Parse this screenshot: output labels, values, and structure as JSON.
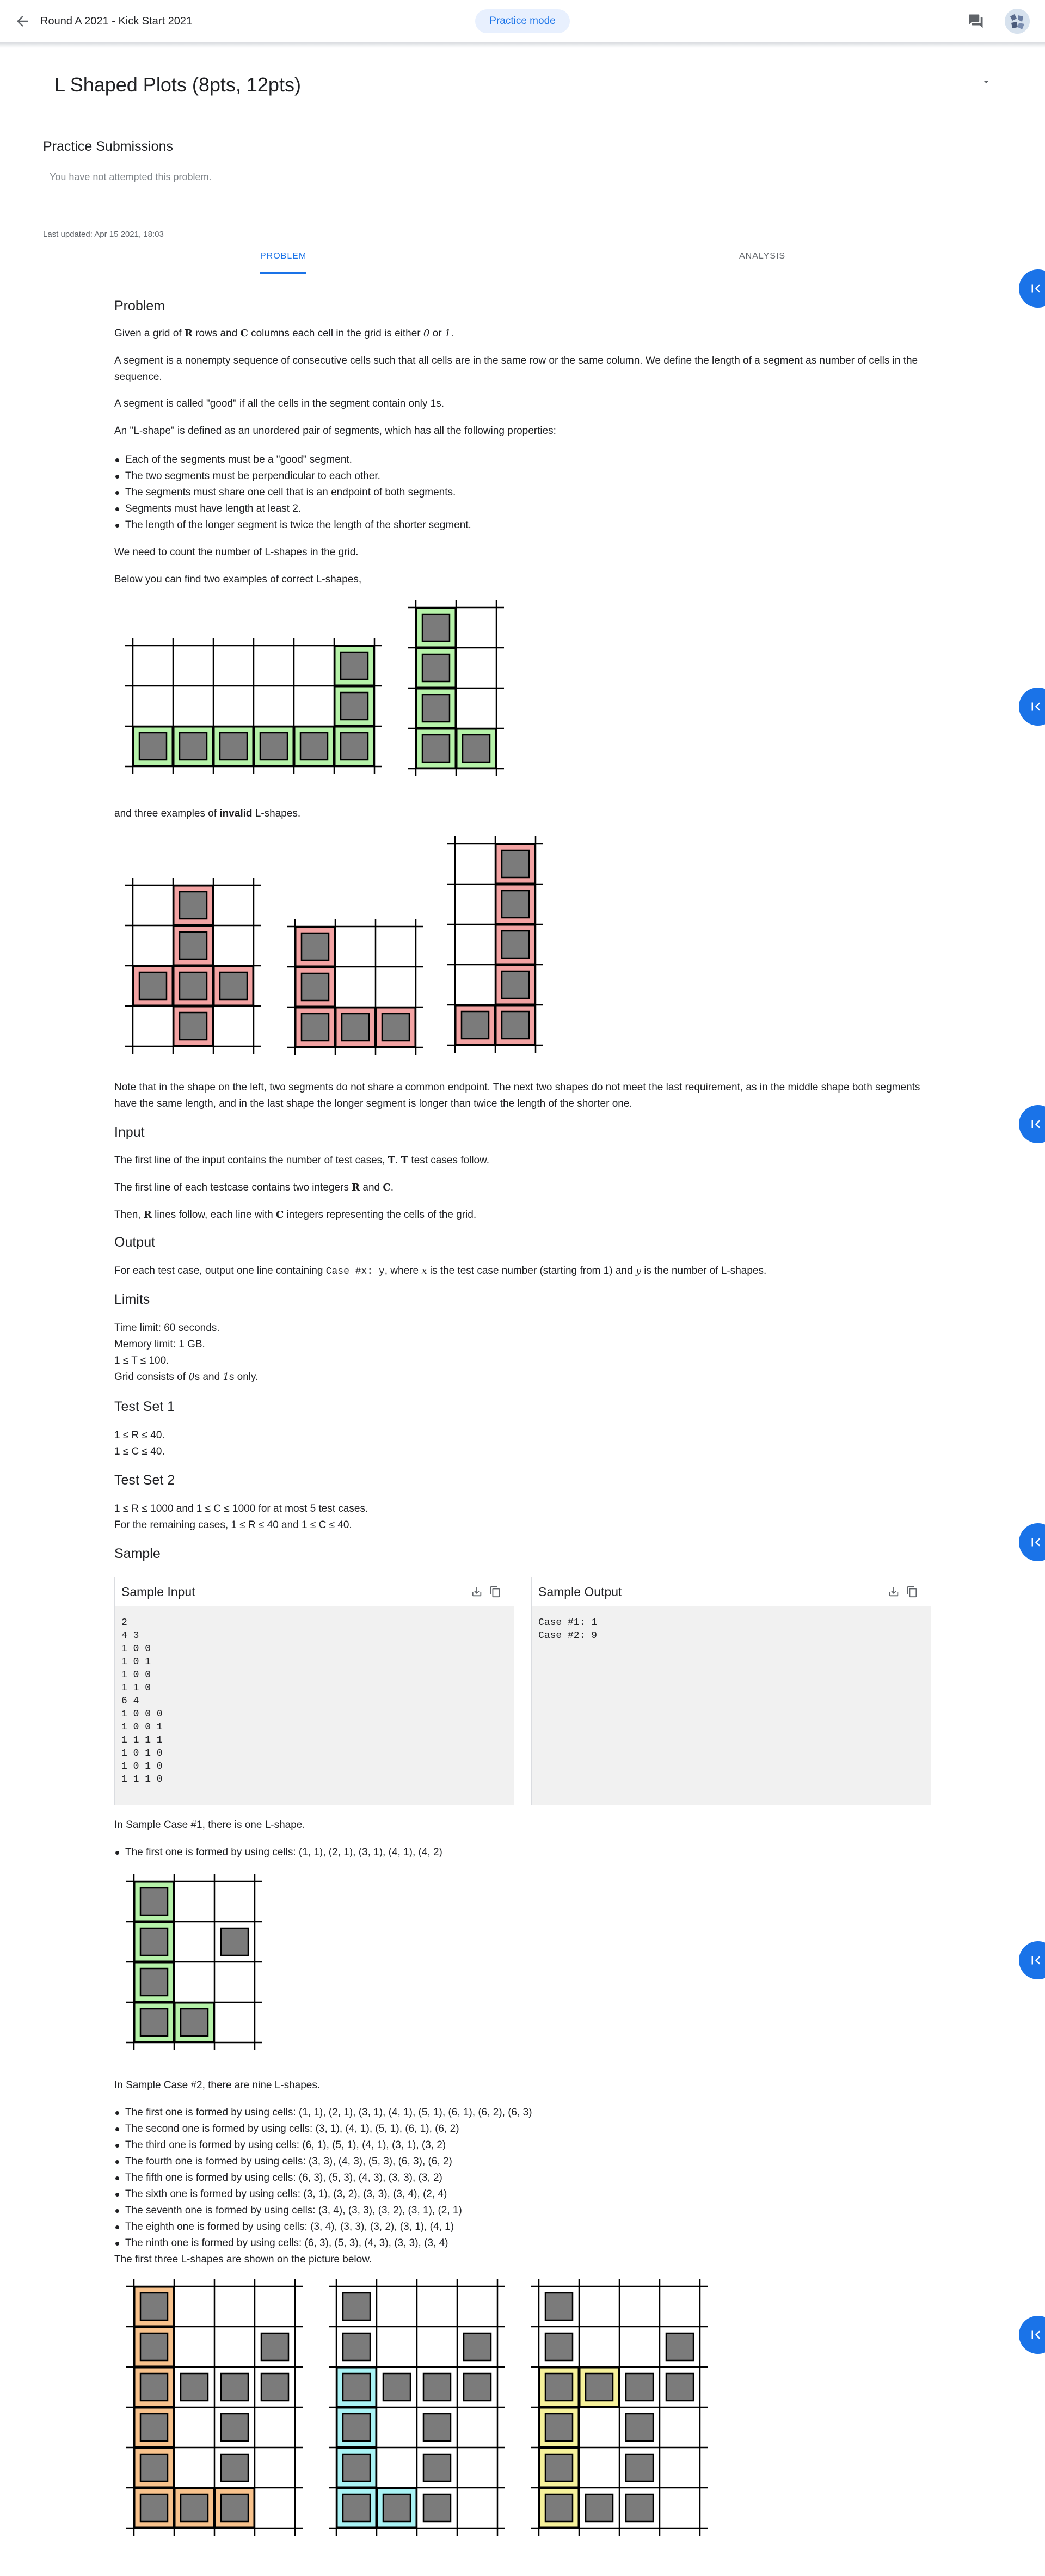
{
  "header": {
    "round_title": "Round A 2021 - Kick Start 2021",
    "mode_label": "Practice mode"
  },
  "problem_title": "L Shaped Plots (8pts, 12pts)",
  "practice": {
    "title": "Practice Submissions",
    "empty_text": "You have not attempted this problem."
  },
  "last_updated": "Last updated: Apr 15 2021, 18:03",
  "tabs": {
    "problem": "PROBLEM",
    "analysis": "ANALYSIS"
  },
  "statement": {
    "problem_heading": "Problem",
    "p1_a": "Given a grid of ",
    "p1_R": "R",
    "p1_b": " rows and ",
    "p1_C": "C",
    "p1_c": " columns each cell in the grid is either ",
    "p1_zero": "0",
    "p1_d": " or ",
    "p1_one": "1",
    "p1_e": ".",
    "p2": "A segment is a nonempty sequence of consecutive cells such that all cells are in the same row or the same column. We define the length of a segment as number of cells in the sequence.",
    "p3": "A segment is called \"good\" if all the cells in the segment contain only 1s.",
    "p4": "An \"L-shape\" is defined as an unordered pair of segments, which has all the following properties:",
    "props": [
      "Each of the segments must be a \"good\" segment.",
      "The two segments must be perpendicular to each other.",
      "The segments must share one cell that is an endpoint of both segments.",
      "Segments must have length at least 2.",
      "The length of the longer segment is twice the length of the shorter segment."
    ],
    "p5": "We need to count the number of L-shapes in the grid.",
    "p6": "Below you can find two examples of correct L-shapes,",
    "p7_a": "and three examples of ",
    "p7_b": "invalid",
    "p7_c": " L-shapes.",
    "p8": "Note that in the shape on the left, two segments do not share a common endpoint. The next two shapes do not meet the last requirement, as in the middle shape both segments have the same length, and in the last shape the longer segment is longer than twice the length of the shorter one.",
    "input_heading": "Input",
    "in1_a": "The first line of the input contains the number of test cases, ",
    "in1_T": "T",
    "in1_b": ". ",
    "in1_T2": "T",
    "in1_c": " test cases follow.",
    "in2_a": "The first line of each testcase contains two integers ",
    "in2_R": "R",
    "in2_b": " and ",
    "in2_C": "C",
    "in2_c": ".",
    "in3_a": "Then, ",
    "in3_R": "R",
    "in3_b": " lines follow, each line with ",
    "in3_C": "C",
    "in3_c": " integers representing the cells of the grid.",
    "output_heading": "Output",
    "out_a": "For each test case, output one line containing ",
    "out_code": "Case #x: y",
    "out_b": ", where ",
    "out_x": "x",
    "out_c": " is the test case number (starting from 1) and ",
    "out_y": "y",
    "out_d": " is the number of L-shapes.",
    "limits_heading": "Limits",
    "lim1": "Time limit: 60 seconds.",
    "lim2": "Memory limit: 1 GB.",
    "lim3": "1 ≤ T ≤ 100.",
    "lim4_a": "Grid consists of ",
    "lim4_0": "0",
    "lim4_b": "s and ",
    "lim4_1": "1",
    "lim4_c": "s only.",
    "ts1_heading": "Test Set 1",
    "ts1_a": "1 ≤ R ≤ 40.",
    "ts1_b": "1 ≤ C ≤ 40.",
    "ts2_heading": "Test Set 2",
    "ts2_a": "1 ≤ R ≤ 1000 and 1 ≤ C ≤ 1000 for at most 5 test cases.",
    "ts2_b": "For the remaining cases, 1 ≤ R ≤ 40 and 1 ≤ C ≤ 40.",
    "sample_heading": "Sample",
    "sc1": "In Sample Case #1, there is one L-shape.",
    "sc1_items": [
      "The first one is formed by using cells: (1, 1), (2, 1), (3, 1), (4, 1), (4, 2)"
    ],
    "sc2": "In Sample Case #2, there are nine L-shapes.",
    "sc2_items": [
      "The first one is formed by using cells: (1, 1), (2, 1), (3, 1), (4, 1), (5, 1), (6, 1), (6, 2), (6, 3)",
      "The second one is formed by using cells: (3, 1), (4, 1), (5, 1), (6, 1), (6, 2)",
      "The third one is formed by using cells: (6, 1), (5, 1), (4, 1), (3, 1), (3, 2)",
      "The fourth one is formed by using cells: (3, 3), (4, 3), (5, 3), (6, 3), (6, 2)",
      "The fifth one is formed by using cells: (6, 3), (5, 3), (4, 3), (3, 3), (3, 2)",
      "The sixth one is formed by using cells: (3, 1), (3, 2), (3, 3), (3, 4), (2, 4)",
      "The seventh one is formed by using cells: (3, 4), (3, 3), (3, 2), (3, 1), (2, 1)",
      "The eighth one is formed by using cells: (3, 4), (3, 3), (3, 2), (3, 1), (4, 1)",
      "The ninth one is formed by using cells: (6, 3), (5, 3), (4, 3), (3, 3), (3, 4)"
    ],
    "sc2_tail": "The first three L-shapes are shown on the picture below."
  },
  "sample_input": {
    "title": "Sample Input",
    "text": "2\n4 3\n1 0 0\n1 0 1\n1 0 0\n1 1 0\n6 4\n1 0 0 0\n1 0 0 1\n1 1 1 1\n1 0 1 0\n1 0 1 0\n1 1 1 0"
  },
  "sample_output": {
    "title": "Sample Output",
    "text": "Case #1: 1\nCase #2: 9"
  },
  "colors": {
    "accent": "#1a73e8",
    "valid_fill": "#b6f2a9",
    "invalid_fill": "#f3a3a3",
    "orange_fill": "#f8c28c",
    "cyan_fill": "#a9f2f4",
    "yellow_fill": "#f6f19a",
    "cell_gray": "#7b7b7b"
  },
  "icons": [
    "arrow-back-icon",
    "chat-icon",
    "avatar",
    "dropdown-caret-icon",
    "download-icon",
    "copy-icon",
    "first-page-icon"
  ]
}
